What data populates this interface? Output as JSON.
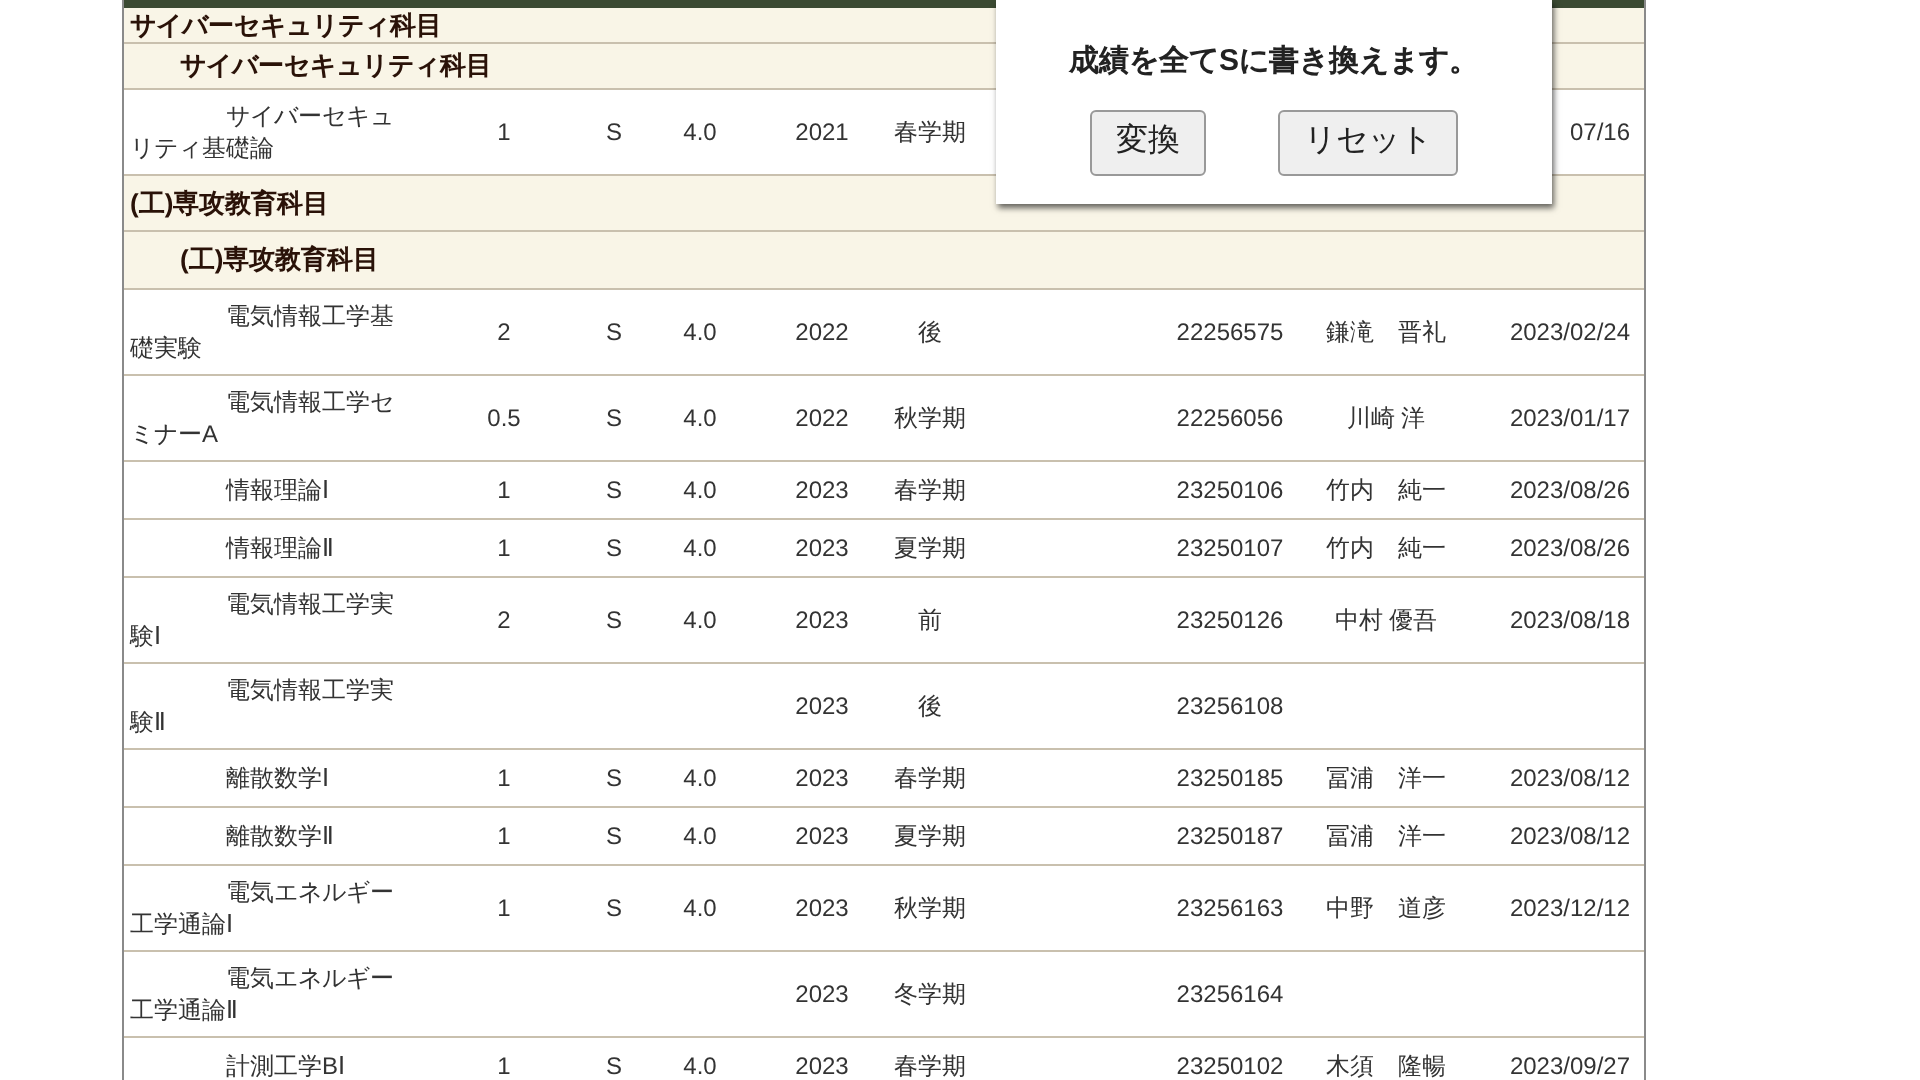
{
  "groups": [
    {
      "title": "サイバーセキュリティ科目",
      "children": [
        {
          "title": "サイバーセキュリティ科目",
          "courses": [
            {
              "name": "サイバーセキュリティ基礎論",
              "credits": "1",
              "grade": "S",
              "gp": "4.0",
              "year": "2021",
              "term": "春学期",
              "date": "07/16"
            }
          ]
        }
      ]
    },
    {
      "title": "(工)専攻教育科目",
      "children": [
        {
          "title": "(工)専攻教育科目",
          "courses": [
            {
              "name": "電気情報工学基礎実験",
              "credits": "2",
              "grade": "S",
              "gp": "4.0",
              "year": "2022",
              "term": "後",
              "number": "22256575",
              "teacher": "鎌滝　晋礼",
              "date": "2023/02/24"
            },
            {
              "name": "電気情報工学セミナーA",
              "credits": "0.5",
              "grade": "S",
              "gp": "4.0",
              "year": "2022",
              "term": "秋学期",
              "number": "22256056",
              "teacher": "川崎 洋",
              "date": "2023/01/17"
            },
            {
              "name": "情報理論Ⅰ",
              "credits": "1",
              "grade": "S",
              "gp": "4.0",
              "year": "2023",
              "term": "春学期",
              "number": "23250106",
              "teacher": "竹内　純一",
              "date": "2023/08/26"
            },
            {
              "name": "情報理論Ⅱ",
              "credits": "1",
              "grade": "S",
              "gp": "4.0",
              "year": "2023",
              "term": "夏学期",
              "number": "23250107",
              "teacher": "竹内　純一",
              "date": "2023/08/26"
            },
            {
              "name": "電気情報工学実験Ⅰ",
              "credits": "2",
              "grade": "S",
              "gp": "4.0",
              "year": "2023",
              "term": "前",
              "number": "23250126",
              "teacher": "中村 優吾",
              "date": "2023/08/18"
            },
            {
              "name": "電気情報工学実験Ⅱ",
              "year": "2023",
              "term": "後",
              "number": "23256108"
            },
            {
              "name": "離散数学Ⅰ",
              "credits": "1",
              "grade": "S",
              "gp": "4.0",
              "year": "2023",
              "term": "春学期",
              "number": "23250185",
              "teacher": "冨浦　洋一",
              "date": "2023/08/12"
            },
            {
              "name": "離散数学Ⅱ",
              "credits": "1",
              "grade": "S",
              "gp": "4.0",
              "year": "2023",
              "term": "夏学期",
              "number": "23250187",
              "teacher": "冨浦　洋一",
              "date": "2023/08/12"
            },
            {
              "name": "電気エネルギー工学通論Ⅰ",
              "credits": "1",
              "grade": "S",
              "gp": "4.0",
              "year": "2023",
              "term": "秋学期",
              "number": "23256163",
              "teacher": "中野　道彦",
              "date": "2023/12/12"
            },
            {
              "name": "電気エネルギー工学通論Ⅱ",
              "year": "2023",
              "term": "冬学期",
              "number": "23256164"
            },
            {
              "name": "計測工学BⅠ",
              "credits": "1",
              "grade": "S",
              "gp": "4.0",
              "year": "2023",
              "term": "春学期",
              "number": "23250102",
              "teacher": "木須　隆暢",
              "date": "2023/09/27"
            }
          ]
        }
      ]
    }
  ],
  "dialog": {
    "message": "成績を全てSに書き換えます。",
    "buttons": [
      "変換",
      "リセット"
    ]
  }
}
